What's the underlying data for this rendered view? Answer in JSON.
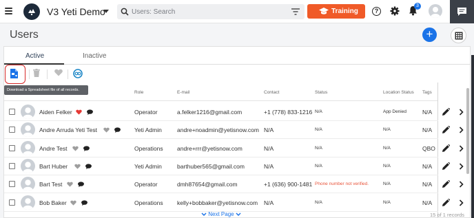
{
  "header": {
    "app_title": "V3 Yeti Demo",
    "search_placeholder": "Users: Search",
    "training_label": "Training",
    "help_glyph": "?",
    "notification_count": "3",
    "training_color": "#f05a28",
    "accent_color": "#1a73e8"
  },
  "page": {
    "title": "Users",
    "add_glyph": "+"
  },
  "tabs": [
    {
      "label": "Active",
      "active": true
    },
    {
      "label": "Inactive",
      "active": false
    }
  ],
  "toolbar": {
    "icons": [
      "spreadsheet-download-icon",
      "trash-icon",
      "heart-icon",
      "qbo-icon"
    ],
    "tooltip": "Download a Spreadsheet file of all records."
  },
  "table": {
    "columns": [
      "Role",
      "E-mail",
      "Contact",
      "Status",
      "Location Status",
      "Tags"
    ],
    "rows": [
      {
        "name": "Aiden Felker",
        "heart_color": "#e53935",
        "role": "Operator",
        "email": "a.felker1216@gmail.com",
        "contact": "+1 (778) 833-1216",
        "status": "N/A",
        "location_status": "App Denied",
        "tags": "N/A"
      },
      {
        "name": "Andre Arruda Yeti Test",
        "heart_color": "#9e9e9e",
        "role": "Yeti Admin",
        "email": "andre+noadmin@yetisnow.com",
        "contact": "N/A",
        "status": "N/A",
        "location_status": "N/A",
        "tags": "N/A"
      },
      {
        "name": "Andre Test",
        "heart_color": "#9e9e9e",
        "role": "Operations",
        "email": "andre+rrr@yetisnow.com",
        "contact": "N/A",
        "status": "N/A",
        "location_status": "N/A",
        "tags": "QBO"
      },
      {
        "name": "Bart Huber",
        "heart_color": "#9e9e9e",
        "role": "Yeti Admin",
        "email": "barthuber565@gmail.com",
        "contact": "N/A",
        "status": "N/A",
        "location_status": "N/A",
        "tags": "N/A"
      },
      {
        "name": "Bart Test",
        "heart_color": "#9e9e9e",
        "role": "Operator",
        "email": "dmh87654@gmail.com",
        "contact": "+1 (636) 900-1481",
        "status": "Phone number not verified.",
        "status_warning": true,
        "location_status": "N/A",
        "tags": "N/A"
      },
      {
        "name": "Bob Baker",
        "heart_color": "#9e9e9e",
        "role": "Operations",
        "email": "kelly+bobbaker@yetisnow.com",
        "contact": "N/A",
        "status": "N/A",
        "location_status": "N/A",
        "tags": "N/A"
      }
    ]
  },
  "footer": {
    "next_page": "Next Page",
    "records": "15 of 1 records"
  }
}
